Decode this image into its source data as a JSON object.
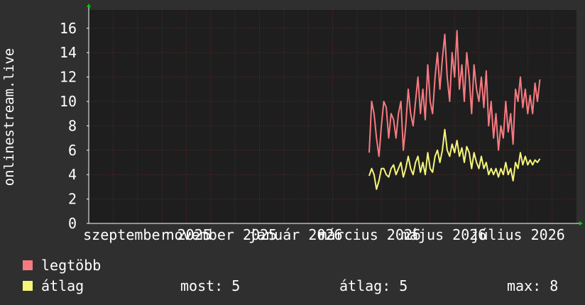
{
  "chart_data": {
    "type": "line",
    "ylabel": "onlinestream.live",
    "ylim": [
      0,
      17.5
    ],
    "yticks": [
      0,
      2,
      4,
      6,
      8,
      10,
      12,
      14,
      16
    ],
    "xlabels": [
      "szeptember 2025",
      "november 2025",
      "január 2026",
      "március 2026",
      "május 2026",
      "július 2026"
    ],
    "grid": true,
    "colors": {
      "background": "#2f2f2f",
      "plot": "#1e1e1e",
      "grid": "#5a2a2a",
      "axis": "#ffffff",
      "arrow": "#00cc00"
    },
    "series": [
      {
        "name": "legtöbb",
        "color": "#f77a80",
        "points": [
          [
            0.575,
            5.8
          ],
          [
            0.58,
            10
          ],
          [
            0.585,
            9
          ],
          [
            0.59,
            7
          ],
          [
            0.595,
            5.5
          ],
          [
            0.6,
            8
          ],
          [
            0.605,
            10
          ],
          [
            0.61,
            9.5
          ],
          [
            0.615,
            7
          ],
          [
            0.62,
            9
          ],
          [
            0.625,
            8.5
          ],
          [
            0.63,
            7
          ],
          [
            0.635,
            9
          ],
          [
            0.64,
            10
          ],
          [
            0.645,
            6
          ],
          [
            0.65,
            8
          ],
          [
            0.655,
            11
          ],
          [
            0.66,
            9
          ],
          [
            0.665,
            8
          ],
          [
            0.67,
            10
          ],
          [
            0.675,
            12
          ],
          [
            0.68,
            9
          ],
          [
            0.685,
            11
          ],
          [
            0.69,
            8.5
          ],
          [
            0.695,
            13
          ],
          [
            0.7,
            10
          ],
          [
            0.705,
            9
          ],
          [
            0.71,
            12
          ],
          [
            0.715,
            14
          ],
          [
            0.72,
            11
          ],
          [
            0.725,
            13.5
          ],
          [
            0.73,
            15.5
          ],
          [
            0.735,
            12
          ],
          [
            0.74,
            10
          ],
          [
            0.745,
            14
          ],
          [
            0.75,
            12
          ],
          [
            0.755,
            15.8
          ],
          [
            0.76,
            11
          ],
          [
            0.765,
            13
          ],
          [
            0.77,
            10
          ],
          [
            0.775,
            14
          ],
          [
            0.78,
            12
          ],
          [
            0.785,
            9
          ],
          [
            0.79,
            13
          ],
          [
            0.795,
            11
          ],
          [
            0.8,
            10
          ],
          [
            0.805,
            12
          ],
          [
            0.81,
            9.5
          ],
          [
            0.815,
            12.5
          ],
          [
            0.82,
            8
          ],
          [
            0.825,
            10
          ],
          [
            0.83,
            7
          ],
          [
            0.835,
            9
          ],
          [
            0.84,
            6
          ],
          [
            0.845,
            8
          ],
          [
            0.85,
            7
          ],
          [
            0.855,
            10
          ],
          [
            0.86,
            7.5
          ],
          [
            0.865,
            9
          ],
          [
            0.87,
            6.5
          ],
          [
            0.875,
            11
          ],
          [
            0.88,
            10
          ],
          [
            0.885,
            12
          ],
          [
            0.89,
            9.5
          ],
          [
            0.895,
            11
          ],
          [
            0.9,
            9
          ],
          [
            0.905,
            10.5
          ],
          [
            0.91,
            9
          ],
          [
            0.915,
            11.5
          ],
          [
            0.92,
            10
          ],
          [
            0.925,
            11.8
          ]
        ]
      },
      {
        "name": "átlag",
        "color": "#f5f57a",
        "points": [
          [
            0.575,
            3.9
          ],
          [
            0.58,
            4.5
          ],
          [
            0.585,
            4
          ],
          [
            0.59,
            2.8
          ],
          [
            0.595,
            3.5
          ],
          [
            0.6,
            4.5
          ],
          [
            0.605,
            4.5
          ],
          [
            0.61,
            4
          ],
          [
            0.615,
            3.8
          ],
          [
            0.62,
            4.5
          ],
          [
            0.625,
            4.8
          ],
          [
            0.63,
            4
          ],
          [
            0.635,
            4.5
          ],
          [
            0.64,
            5
          ],
          [
            0.645,
            3.8
          ],
          [
            0.65,
            4.5
          ],
          [
            0.655,
            5.5
          ],
          [
            0.66,
            4.5
          ],
          [
            0.665,
            4
          ],
          [
            0.67,
            5
          ],
          [
            0.675,
            5.5
          ],
          [
            0.68,
            4.2
          ],
          [
            0.685,
            5
          ],
          [
            0.69,
            4
          ],
          [
            0.695,
            5.8
          ],
          [
            0.7,
            4.5
          ],
          [
            0.705,
            4.2
          ],
          [
            0.71,
            5.5
          ],
          [
            0.715,
            6
          ],
          [
            0.72,
            5
          ],
          [
            0.725,
            6
          ],
          [
            0.73,
            7.7
          ],
          [
            0.735,
            6
          ],
          [
            0.74,
            5.5
          ],
          [
            0.745,
            6.5
          ],
          [
            0.75,
            5.8
          ],
          [
            0.755,
            6.8
          ],
          [
            0.76,
            5.5
          ],
          [
            0.765,
            6.2
          ],
          [
            0.77,
            5
          ],
          [
            0.775,
            6.3
          ],
          [
            0.78,
            5.8
          ],
          [
            0.785,
            4.5
          ],
          [
            0.79,
            5.8
          ],
          [
            0.795,
            5
          ],
          [
            0.8,
            4.5
          ],
          [
            0.805,
            5.5
          ],
          [
            0.81,
            4.5
          ],
          [
            0.815,
            5
          ],
          [
            0.82,
            4
          ],
          [
            0.825,
            4.5
          ],
          [
            0.83,
            4
          ],
          [
            0.835,
            4.5
          ],
          [
            0.84,
            3.8
          ],
          [
            0.845,
            4.5
          ],
          [
            0.85,
            4
          ],
          [
            0.855,
            5
          ],
          [
            0.86,
            4
          ],
          [
            0.865,
            4.5
          ],
          [
            0.87,
            3.5
          ],
          [
            0.875,
            5
          ],
          [
            0.88,
            4.5
          ],
          [
            0.885,
            5.8
          ],
          [
            0.89,
            4.8
          ],
          [
            0.895,
            5.5
          ],
          [
            0.9,
            4.8
          ],
          [
            0.905,
            5.2
          ],
          [
            0.91,
            4.8
          ],
          [
            0.915,
            5.2
          ],
          [
            0.92,
            5
          ],
          [
            0.925,
            5.3
          ]
        ]
      }
    ]
  },
  "legend": {
    "max_label": "legtöbb",
    "avg_label": "átlag",
    "max_color": "#f77a80",
    "avg_color": "#f5f57a"
  },
  "stats": {
    "now": "most: 5",
    "avg": "átlag: 5",
    "max": "max: 8"
  }
}
